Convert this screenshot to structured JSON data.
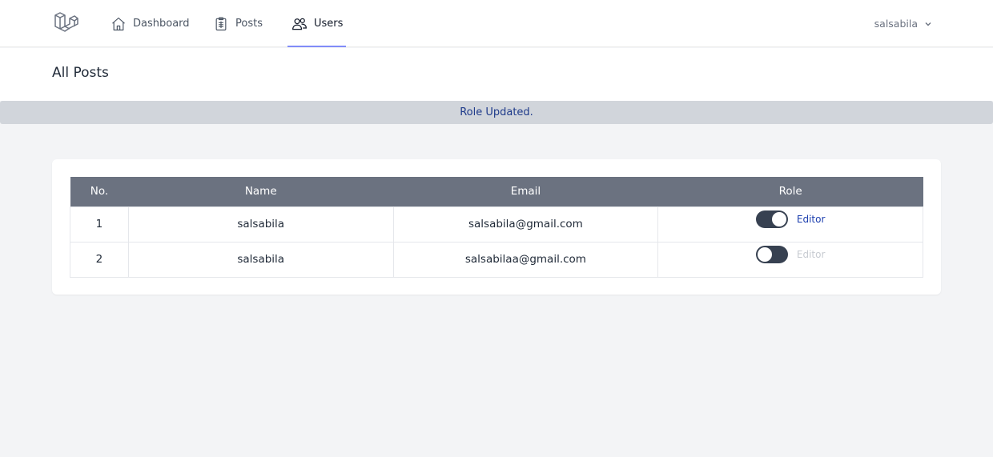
{
  "nav": {
    "items": [
      {
        "label": "Dashboard",
        "icon": "home-icon",
        "active": false
      },
      {
        "label": "Posts",
        "icon": "clipboard-icon",
        "active": false
      },
      {
        "label": "Users",
        "icon": "users-icon",
        "active": true
      }
    ],
    "user_name": "salsabila"
  },
  "page": {
    "title": "All Posts"
  },
  "flash": {
    "message": "Role Updated."
  },
  "table": {
    "headers": [
      "No.",
      "Name",
      "Email",
      "Role"
    ],
    "rows": [
      {
        "no": "1",
        "name": "salsabila",
        "email": "salsabila@gmail.com",
        "role_label": "Editor",
        "role_enabled": true
      },
      {
        "no": "2",
        "name": "salsabila",
        "email": "salsabilaa@gmail.com",
        "role_label": "Editor",
        "role_enabled": false
      }
    ]
  },
  "colors": {
    "accent": "#818cf8",
    "table_header": "#6b7280",
    "flash_bg": "#d1d5db",
    "flash_text": "#1e3a8a",
    "toggle_bg": "#374151"
  }
}
